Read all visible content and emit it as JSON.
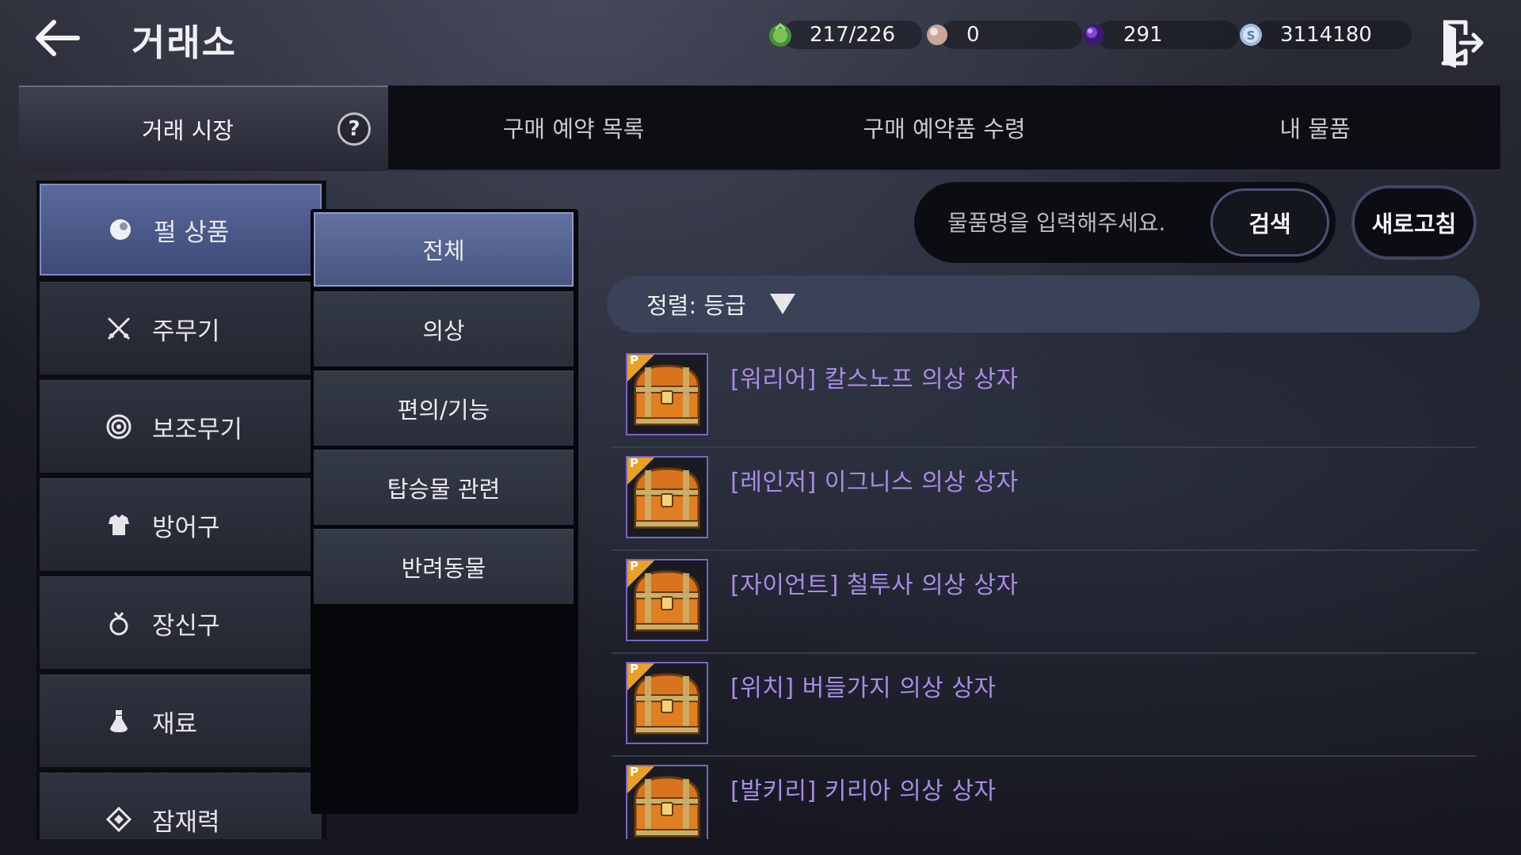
{
  "header": {
    "title": "거래소",
    "back_icon": "arrow-left-icon",
    "exit_icon": "exit-door-icon"
  },
  "currencies": [
    {
      "name": "weight",
      "icon": "green-bag-icon",
      "value": "217/226",
      "color": "#5fa04a"
    },
    {
      "name": "pearl",
      "icon": "pearl-icon",
      "value": "0",
      "color": "#d9b8ad"
    },
    {
      "name": "black-pearl",
      "icon": "purple-orb-icon",
      "value": "291",
      "color": "#6b2fc0"
    },
    {
      "name": "silver",
      "icon": "silver-coin-icon",
      "value": "3114180",
      "color": "#8fb0d8"
    }
  ],
  "tabs": [
    {
      "label": "거래 시장",
      "active": true
    },
    {
      "label": "구매 예약 목록",
      "active": false
    },
    {
      "label": "구매 예약품 수령",
      "active": false
    },
    {
      "label": "내 물품",
      "active": false
    }
  ],
  "help_label": "?",
  "categories": [
    {
      "label": "펄 상품",
      "icon": "pearl-icon",
      "active": true
    },
    {
      "label": "주무기",
      "icon": "crossed-swords-icon",
      "active": false
    },
    {
      "label": "보조무기",
      "icon": "target-icon",
      "active": false
    },
    {
      "label": "방어구",
      "icon": "armor-icon",
      "active": false
    },
    {
      "label": "장신구",
      "icon": "ring-icon",
      "active": false
    },
    {
      "label": "재료",
      "icon": "potion-icon",
      "active": false
    },
    {
      "label": "잠재력",
      "icon": "diamond-icon",
      "active": false
    }
  ],
  "subcategories": [
    {
      "label": "전체",
      "active": true
    },
    {
      "label": "의상",
      "active": false
    },
    {
      "label": "편의/기능",
      "active": false
    },
    {
      "label": "탑승물 관련",
      "active": false
    },
    {
      "label": "반려동물",
      "active": false
    }
  ],
  "search": {
    "placeholder": "물품명을 입력해주세요.",
    "value": "",
    "button_label": "검색"
  },
  "refresh_label": "새로고침",
  "sort": {
    "label": "정렬: 등급"
  },
  "items": [
    {
      "name": "[워리어] 칼스노프 의상 상자",
      "badge": "P",
      "icon": "treasure-chest-icon"
    },
    {
      "name": "[레인저] 이그니스 의상 상자",
      "badge": "P",
      "icon": "treasure-chest-icon"
    },
    {
      "name": "[자이언트] 철투사 의상 상자",
      "badge": "P",
      "icon": "treasure-chest-icon"
    },
    {
      "name": "[위치] 버들가지 의상 상자",
      "badge": "P",
      "icon": "treasure-chest-icon"
    },
    {
      "name": "[발키리] 키리아 의상 상자",
      "badge": "P",
      "icon": "treasure-chest-icon"
    }
  ],
  "colors": {
    "accent": "#5b6a9c",
    "item_name": "#a98be6",
    "item_border": "#7b62c7",
    "badge": "#e8a122"
  }
}
